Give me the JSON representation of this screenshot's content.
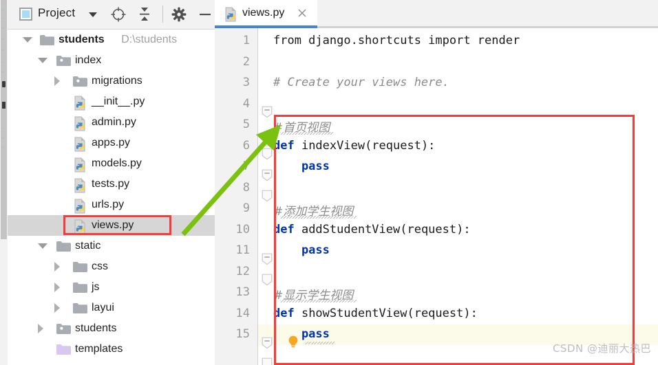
{
  "window": {
    "left_strip": {
      "name": "collapsed-tool-window-strip"
    }
  },
  "project_panel": {
    "toolbar": {
      "title": "Project",
      "dropdown_caret": "chevron-down-icon",
      "buttons": [
        {
          "name": "select-opened-file-button",
          "icon": "crosshair-target-icon",
          "label": "Select Opened File"
        },
        {
          "name": "collapse-all-button",
          "icon": "collapse-all-icon",
          "label": "Collapse All"
        },
        {
          "name": "settings-button",
          "icon": "gear-icon",
          "label": "Settings"
        },
        {
          "name": "hide-button",
          "icon": "minimize-dash-icon",
          "label": "Hide"
        }
      ]
    },
    "tree": [
      {
        "label": "students",
        "path": "D:\\students",
        "indent": 0,
        "twisty": "down",
        "icon": "folder-icon",
        "bold": true,
        "selected": false
      },
      {
        "label": "index",
        "path": "",
        "indent": 1,
        "twisty": "down",
        "icon": "module-folder-icon",
        "bold": false,
        "selected": false
      },
      {
        "label": "migrations",
        "path": "",
        "indent": 2,
        "twisty": "right",
        "icon": "module-folder-icon",
        "bold": false,
        "selected": false
      },
      {
        "label": "__init__.py",
        "path": "",
        "indent": 3,
        "twisty": "none",
        "icon": "python-file-icon",
        "bold": false,
        "selected": false
      },
      {
        "label": "admin.py",
        "path": "",
        "indent": 3,
        "twisty": "none",
        "icon": "python-file-icon",
        "bold": false,
        "selected": false
      },
      {
        "label": "apps.py",
        "path": "",
        "indent": 3,
        "twisty": "none",
        "icon": "python-file-icon",
        "bold": false,
        "selected": false
      },
      {
        "label": "models.py",
        "path": "",
        "indent": 3,
        "twisty": "none",
        "icon": "python-file-icon",
        "bold": false,
        "selected": false
      },
      {
        "label": "tests.py",
        "path": "",
        "indent": 3,
        "twisty": "none",
        "icon": "python-file-icon",
        "bold": false,
        "selected": false
      },
      {
        "label": "urls.py",
        "path": "",
        "indent": 3,
        "twisty": "none",
        "icon": "python-file-icon",
        "bold": false,
        "selected": false
      },
      {
        "label": "views.py",
        "path": "",
        "indent": 3,
        "twisty": "none",
        "icon": "python-file-icon",
        "bold": false,
        "selected": true
      },
      {
        "label": "static",
        "path": "",
        "indent": 1,
        "twisty": "down",
        "icon": "folder-icon",
        "bold": false,
        "selected": false
      },
      {
        "label": "css",
        "path": "",
        "indent": 2,
        "twisty": "right",
        "icon": "folder-icon",
        "bold": false,
        "selected": false
      },
      {
        "label": "js",
        "path": "",
        "indent": 2,
        "twisty": "right",
        "icon": "folder-icon",
        "bold": false,
        "selected": false
      },
      {
        "label": "layui",
        "path": "",
        "indent": 2,
        "twisty": "right",
        "icon": "folder-icon",
        "bold": false,
        "selected": false
      },
      {
        "label": "students",
        "path": "",
        "indent": 1,
        "twisty": "right",
        "icon": "module-folder-icon",
        "bold": false,
        "selected": false
      },
      {
        "label": "templates",
        "path": "",
        "indent": 1,
        "twisty": "none",
        "icon": "templates-folder-icon",
        "bold": false,
        "selected": false
      }
    ]
  },
  "editor": {
    "tab": {
      "label": "views.py",
      "icon": "python-file-icon",
      "close_icon": "close-icon",
      "active": true
    },
    "line_numbers": [
      "1",
      "2",
      "3",
      "4",
      "5",
      "6",
      "7",
      "8",
      "9",
      "10",
      "11",
      "12",
      "13",
      "14",
      "15"
    ],
    "highlighted_line": 15,
    "bulb_line": 15,
    "bulb_icon": "lightbulb-icon",
    "lines": [
      {
        "n": 1,
        "segments": [
          {
            "t": "from django.shortcuts import render",
            "k": "plain"
          }
        ]
      },
      {
        "n": 2,
        "segments": []
      },
      {
        "n": 3,
        "segments": [
          {
            "t": "# Create your views here.",
            "k": "comment"
          }
        ]
      },
      {
        "n": 4,
        "segments": []
      },
      {
        "n": 5,
        "segments": [
          {
            "t": "#首页视图",
            "k": "comment-cjk"
          }
        ]
      },
      {
        "n": 6,
        "segments": [
          {
            "t": "def",
            "k": "keyword"
          },
          {
            "t": " indexView(request):",
            "k": "plain"
          }
        ]
      },
      {
        "n": 7,
        "segments": [
          {
            "t": "    pass",
            "k": "keyword"
          }
        ]
      },
      {
        "n": 8,
        "segments": []
      },
      {
        "n": 9,
        "segments": [
          {
            "t": "#添加学生视图",
            "k": "comment-cjk"
          }
        ]
      },
      {
        "n": 10,
        "segments": [
          {
            "t": "def",
            "k": "keyword"
          },
          {
            "t": " addStudentView(request):",
            "k": "plain"
          }
        ]
      },
      {
        "n": 11,
        "segments": [
          {
            "t": "    pass",
            "k": "keyword"
          }
        ]
      },
      {
        "n": 12,
        "segments": []
      },
      {
        "n": 13,
        "segments": [
          {
            "t": "#显示学生视图",
            "k": "comment-cjk"
          }
        ]
      },
      {
        "n": 14,
        "segments": [
          {
            "t": "def",
            "k": "keyword"
          },
          {
            "t": " showStudentView(request):",
            "k": "plain"
          }
        ]
      },
      {
        "n": 15,
        "segments": [
          {
            "t": "    pass",
            "k": "keyword"
          }
        ]
      }
    ]
  },
  "annotations": {
    "highlight_color": "#f93a3a",
    "arrow_color": "#7ac20f",
    "file_box": {
      "name": "views-py-highlight-box"
    },
    "code_box": {
      "name": "code-block-highlight-box"
    },
    "arrow": {
      "name": "green-pointer-arrow"
    }
  },
  "watermark": {
    "text": "CSDN @迪丽大热巴"
  }
}
